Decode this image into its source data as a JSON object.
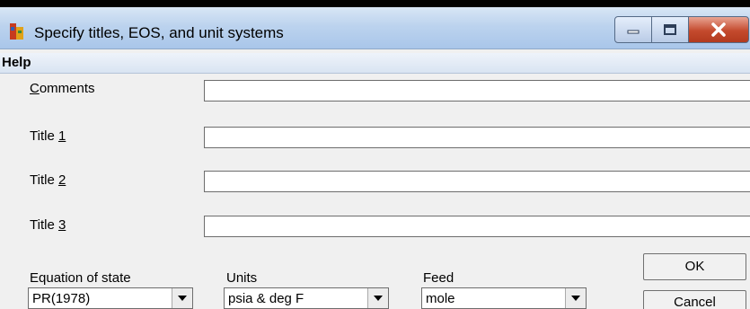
{
  "window": {
    "title": "Specify titles, EOS, and unit systems",
    "icon": "app-icon"
  },
  "menu": {
    "help": "Help"
  },
  "form": {
    "comments_label": {
      "pre": "",
      "key": "C",
      "post": "omments"
    },
    "title1_label": {
      "pre": "Title ",
      "key": "1",
      "post": ""
    },
    "title2_label": {
      "pre": "Title ",
      "key": "2",
      "post": ""
    },
    "title3_label": {
      "pre": "Title ",
      "key": "3",
      "post": ""
    },
    "comments_value": "",
    "title1_value": "",
    "title2_value": "",
    "title3_value": ""
  },
  "eos": {
    "label": "Equation of state",
    "value": "PR(1978)"
  },
  "units": {
    "label": "Units",
    "value": "psia & deg F"
  },
  "feed": {
    "label": "Feed",
    "value": "mole"
  },
  "buttons": {
    "ok": "OK",
    "cancel": "Cancel"
  },
  "colors": {
    "title_bar": "#bcd3ee",
    "close_button": "#c44a2d",
    "dialog_bg": "#f0f0f0"
  }
}
